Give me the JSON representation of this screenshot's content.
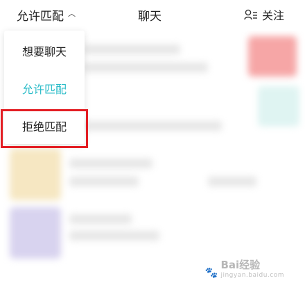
{
  "topbar": {
    "match_label": "允许匹配",
    "title": "聊天",
    "follow_label": "关注"
  },
  "menu": {
    "items": [
      {
        "label": "想要聊天",
        "state": "normal"
      },
      {
        "label": "允许匹配",
        "state": "selected"
      },
      {
        "label": "拒绝匹配",
        "state": "highlighted"
      }
    ],
    "accent_color": "#2bbcc8",
    "highlight_color": "#e31e24"
  },
  "watermark": {
    "brand": "Bai",
    "brand_suffix": "经验",
    "sub": "jingyan.baidu.com"
  }
}
